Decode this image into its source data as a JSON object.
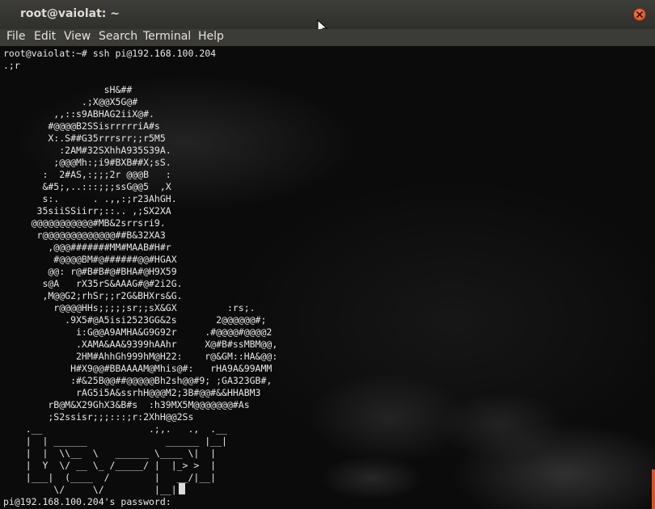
{
  "window": {
    "title": "root@vaiolat: ~"
  },
  "menu": [
    {
      "label": "File"
    },
    {
      "label": "Edit"
    },
    {
      "label": "View"
    },
    {
      "label": "Search"
    },
    {
      "label": "Terminal"
    },
    {
      "label": "Help"
    }
  ],
  "terminal": {
    "lines": [
      "root@vaiolat:~# ssh pi@192.168.100.204",
      ".;r",
      "",
      "                  sH&##",
      "              .;X@@X5G@#",
      "         ,,::s9ABHAG2iiX@#.",
      "        #@@@@B2SSisrrrrriA#s",
      "        X:.S##G35rrrsrr;;r5M5",
      "          :2AM#32SXhhA935S39A.",
      "         ;@@@Mh:;i9#BXB##X;sS.",
      "       :  2#AS,:;;;2r @@@B   :",
      "       &#5;,..:::;;;ssG@@5  ,X",
      "       s:.      . .,,:;r23AhGH.",
      "      35siiSSiirr;::.. ,;SX2XA",
      "     @@@@@@@@@@@#MB&2srrsri9.",
      "      r@@@@@@@@@@@@@##B&32XA3",
      "        ,@@@#######MM#MAAB#H#r",
      "         #@@@@BM#@######@@#HGAX",
      "        @@: r@#B#B#@#BHA#@H9X59",
      "       s@A   rX35rS&AAAG#@#2i2G.",
      "       ,M@@G2;rhSr;;r2G&BHXrs&G.",
      "         r@@@@HHs;;;;;sr;;sX&GX         :rs;.",
      "           .9X5#@A5isi2523GG&2s       2@@@@@@#;",
      "             i:G@@A9AMHA&G9G92r     .#@@@@#@@@@2",
      "             .XAMA&AA&9399hAAhr     X@#B#ssMBM@@,",
      "             2HM#AhhGh999hM@H22:    r@&GM::HA&@@:",
      "            H#X9@@#BBAAAAM@Mhis@#:   rHA9A&99AMM",
      "            :#&25B@@##@@@@@Bh2sh@@#9; ;GA323GB#,",
      "             rAG5i5A&ssrhH@@@M2;3B#@@#&&HHABM3",
      "        rB@M&X29GhX3&B#s  :h39MX5M@@@@@@@#As",
      "        ;S2ssisr;;;:::;r:2XhH@@2Ss",
      "    .__                   .;,.   .,  .__",
      "    |  | ______              ______ |__|",
      "    |  |  \\\\__  \\   ______ \\____ \\|  |",
      "    |  Y  \\/ __ \\_ /_____/ |  |_> >  |",
      "    |___|  (____  /        |   __/|__|",
      "         \\/     \\/         |__|",
      "pi@192.168.100.204's password: "
    ]
  }
}
